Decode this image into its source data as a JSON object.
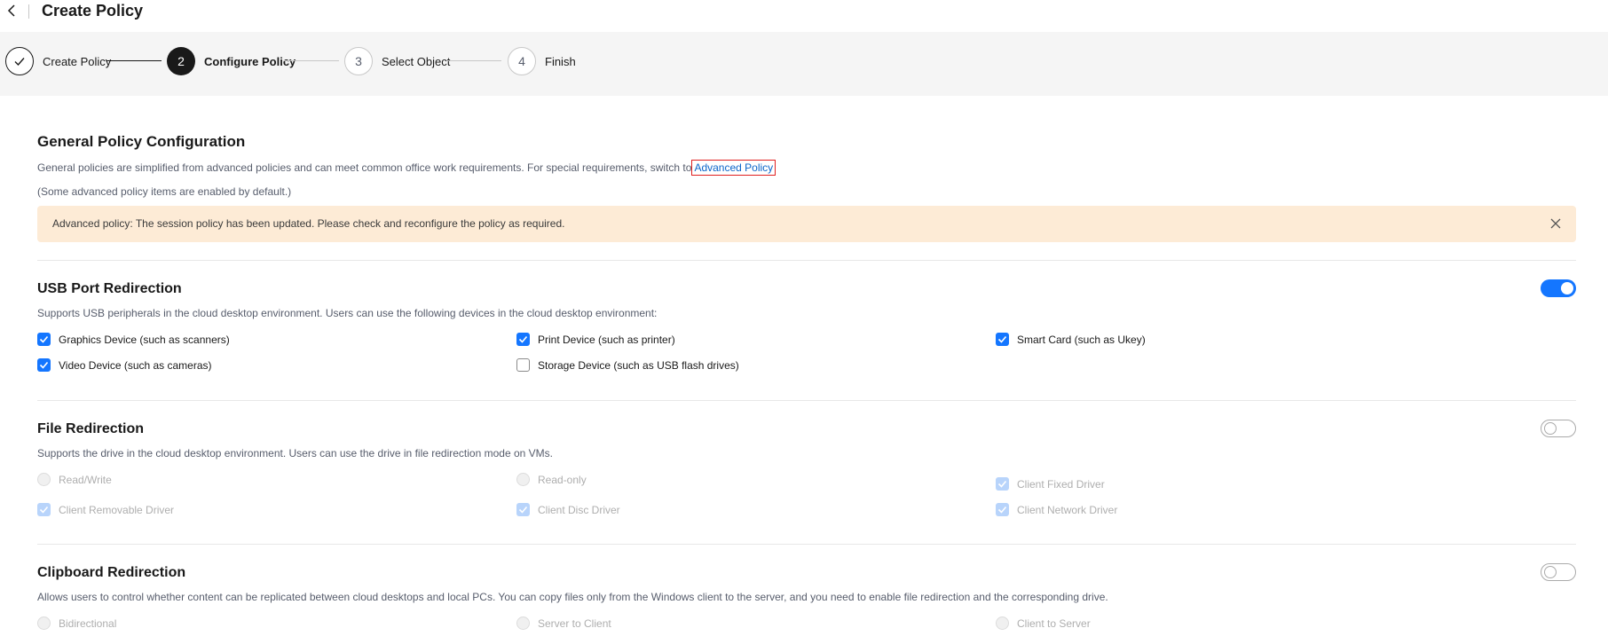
{
  "header": {
    "title": "Create Policy"
  },
  "stepper": {
    "steps": [
      {
        "number": "",
        "label": "Create Policy",
        "state": "done"
      },
      {
        "number": "2",
        "label": "Configure Policy",
        "state": "active"
      },
      {
        "number": "3",
        "label": "Select Object",
        "state": "todo"
      },
      {
        "number": "4",
        "label": "Finish",
        "state": "todo"
      }
    ]
  },
  "general": {
    "title": "General Policy Configuration",
    "desc": "General policies are simplified from advanced policies and can meet common office work requirements. For special requirements, switch to",
    "link": "Advanced Policy",
    "note": "(Some advanced policy items are enabled by default.)"
  },
  "alert": {
    "text": "Advanced policy: The session policy has been updated. Please check and reconfigure the policy as required."
  },
  "usb": {
    "title": "USB Port Redirection",
    "enabled": true,
    "desc": "Supports USB peripherals in the cloud desktop environment. Users can use the following devices in the cloud desktop environment:",
    "options": [
      {
        "label": "Graphics Device (such as scanners)",
        "checked": true
      },
      {
        "label": "Print Device (such as printer)",
        "checked": true
      },
      {
        "label": "Smart Card (such as Ukey)",
        "checked": true
      },
      {
        "label": "Video Device (such as cameras)",
        "checked": true
      },
      {
        "label": "Storage Device (such as USB flash drives)",
        "checked": false
      }
    ]
  },
  "file": {
    "title": "File Redirection",
    "enabled": false,
    "desc": "Supports the drive in the cloud desktop environment. Users can use the drive in file redirection mode on VMs.",
    "options": [
      {
        "label": "Read/Write"
      },
      {
        "label": "Read-only"
      },
      {
        "label": "Client Fixed Driver",
        "checked": true
      },
      {
        "label": "Client Removable Driver",
        "checked": true
      },
      {
        "label": "Client Disc Driver",
        "checked": true
      },
      {
        "label": "Client Network Driver",
        "checked": true
      }
    ]
  },
  "clipboard": {
    "title": "Clipboard Redirection",
    "enabled": false,
    "desc": "Allows users to control whether content can be replicated between cloud desktops and local PCs. You can copy files only from the Windows client to the server, and you need to enable file redirection and the corresponding drive.",
    "options": [
      {
        "label": "Bidirectional"
      },
      {
        "label": "Server to Client"
      },
      {
        "label": "Client to Server"
      }
    ]
  },
  "colors": {
    "accent": "#1476ff",
    "link": "#0b65c9",
    "alert_bg": "#fdebd6"
  }
}
